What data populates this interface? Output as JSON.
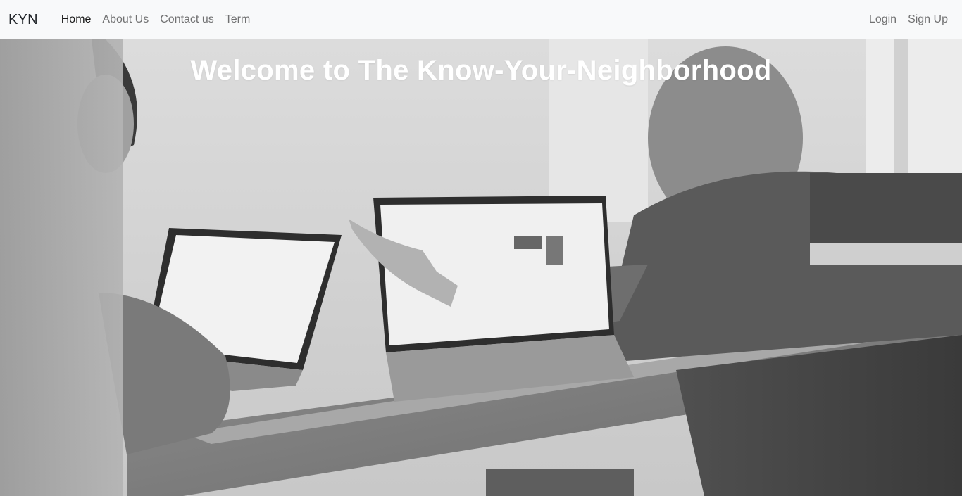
{
  "navbar": {
    "brand": "KYN",
    "left_links": [
      {
        "label": "Home",
        "active": true
      },
      {
        "label": "About Us",
        "active": false
      },
      {
        "label": "Contact us",
        "active": false
      },
      {
        "label": "Term",
        "active": false
      }
    ],
    "right_links": [
      {
        "label": "Login"
      },
      {
        "label": "Sign Up"
      }
    ]
  },
  "hero": {
    "title": "Welcome to The Know-Your-Neighborhood",
    "image": "grayscale photo of two people working on laptops at a desk"
  },
  "colors": {
    "navbar_bg": "#f8f9fa",
    "title_text": "#ffffff",
    "link_active": "#1a1a1a",
    "link_muted": "#737373"
  }
}
